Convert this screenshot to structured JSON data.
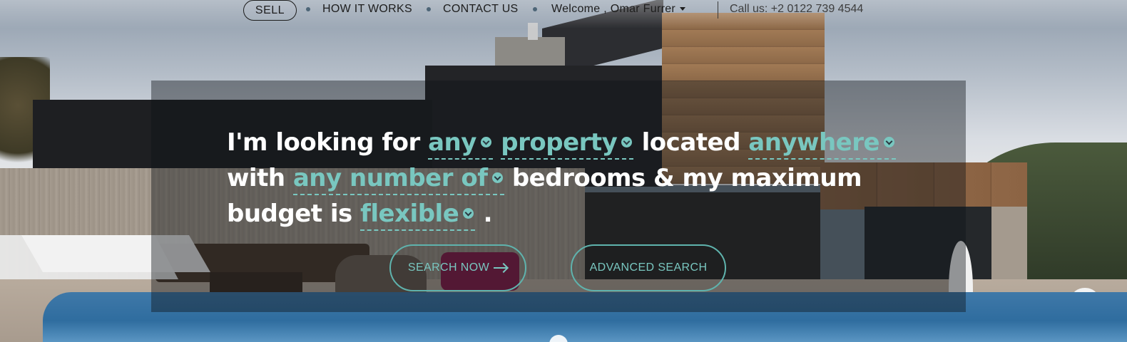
{
  "nav": {
    "sell_label": "SELL",
    "how_it_works_label": "HOW IT WORKS",
    "contact_us_label": "CONTACT US",
    "welcome_label": "Welcome , Omar Furrer",
    "call_label": "Call us: +2 0122 739 4544"
  },
  "search_sentence": {
    "text1": "I'm looking for ",
    "type_value": "any",
    "property_value": "property",
    "text2": " located ",
    "location_value": "anywhere",
    "text3": "with ",
    "bedrooms_value": "any number of",
    "text4": " bedrooms & my maximum",
    "text5": "budget is ",
    "budget_value": "flexible",
    "text6": " ."
  },
  "buttons": {
    "search_now_label": "SEARCH NOW",
    "advanced_search_label": "ADVANCED SEARCH"
  },
  "icons": {
    "dropdown": "chevron-down-icon",
    "arrow": "arrow-right-icon",
    "caret": "caret-down-icon"
  },
  "colors": {
    "accent": "#79c7c0",
    "nav_text": "#1d1d1d",
    "nav_dot": "#4d6577"
  }
}
